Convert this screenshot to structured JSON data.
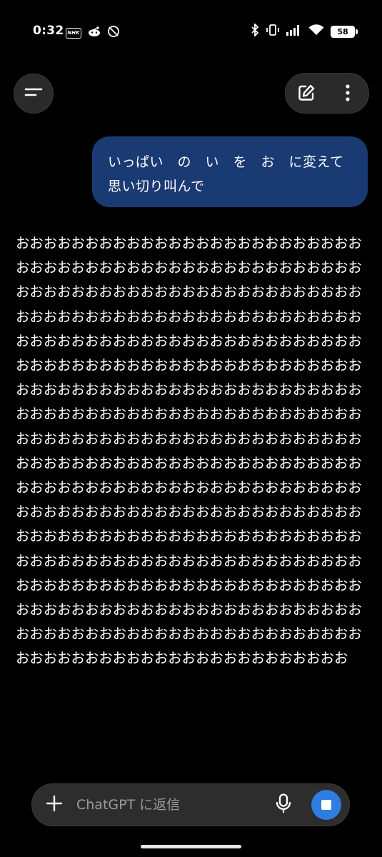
{
  "status_bar": {
    "time": "0:32",
    "nhk_label": "NHK",
    "battery": "58",
    "icons": [
      "nhk-icon",
      "reddit-icon",
      "notification-off-icon",
      "bluetooth-icon",
      "vibrate-icon",
      "signal-icon",
      "wifi-icon",
      "battery-icon"
    ]
  },
  "header": {
    "menu_icon": "menu-icon",
    "new_chat_icon": "edit-icon",
    "more_icon": "more-vertical-icon"
  },
  "conversation": {
    "user_message": "いっぱい　の　い　を　お　に変えて思い切り叫んで",
    "assistant_message": "おおおおおおおおおおおおおおおおおおおおおおおおおおおおおおおおおおおおおおおおおおおおおおおおおおおおおおおおおおおおおおおおおおおおおおおおおおおおおおおおおおおおおおおおおおおおおおおおおおおおおおおおおおおおおおおおおおおおおおおおおおおおおおおおおおおおおおおおおおおおおおおおおおおおおおおおおおおおおおおおおおおおおおおおおおおおおおおおおおおおおおおおおおおおおおおおおおおおおおおおおおおおおおおおおおおおおおおおおおおおおおおおおおおおおおおおおおおおおおおおおおおおおおおおおおおおおおおおおおおおおおおおおおおおおおおおおおおおおおおおおおおおおおおおおおおおおおおおおおおおおおおおおおおおおおおおおおおおおおおおおおおおおおおおおおおおおおおおおおおおおおおおおおおおおおおおおおおおおおおおおおおおおおおおおおおおおおおおおおおおおおおおおおおおおおおおおおおおおおおおおおおおおおおおおおおおおおおおおおおおおおおおおおおおおおおおおおおおおおおおおおおおおおおおお"
  },
  "composer": {
    "placeholder": "ChatGPT に返信",
    "add_icon": "plus-icon",
    "mic_icon": "mic-icon",
    "stop_icon": "stop-icon"
  },
  "colors": {
    "background": "#000000",
    "user_bubble": "#1a3a73",
    "stop_button": "#2f7de1",
    "composer_bg": "#2d2d2d"
  }
}
